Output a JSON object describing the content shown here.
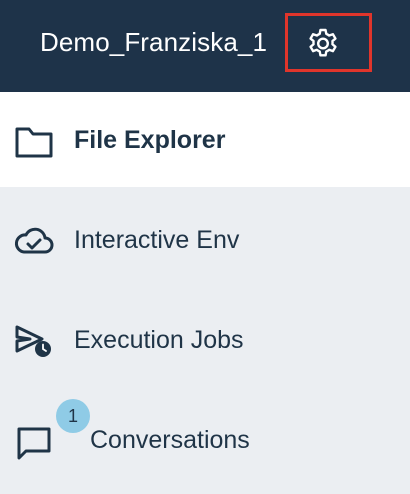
{
  "header": {
    "project_name": "Demo_Franziska_1",
    "settings_icon": "gear-icon"
  },
  "nav": {
    "items": [
      {
        "label": "File Explorer",
        "icon": "folder-icon",
        "active": true
      },
      {
        "label": "Interactive Env",
        "icon": "cloud-check-icon",
        "active": false
      },
      {
        "label": "Execution Jobs",
        "icon": "send-clock-icon",
        "active": false
      },
      {
        "label": "Conversations",
        "icon": "chat-icon",
        "active": false,
        "badge": "1"
      }
    ]
  },
  "colors": {
    "header_bg": "#1e3349",
    "panel_bg": "#ebeef2",
    "active_bg": "#ffffff",
    "text": "#1f3447",
    "highlight_border": "#e0352b",
    "badge_bg": "#8fcbe6"
  }
}
